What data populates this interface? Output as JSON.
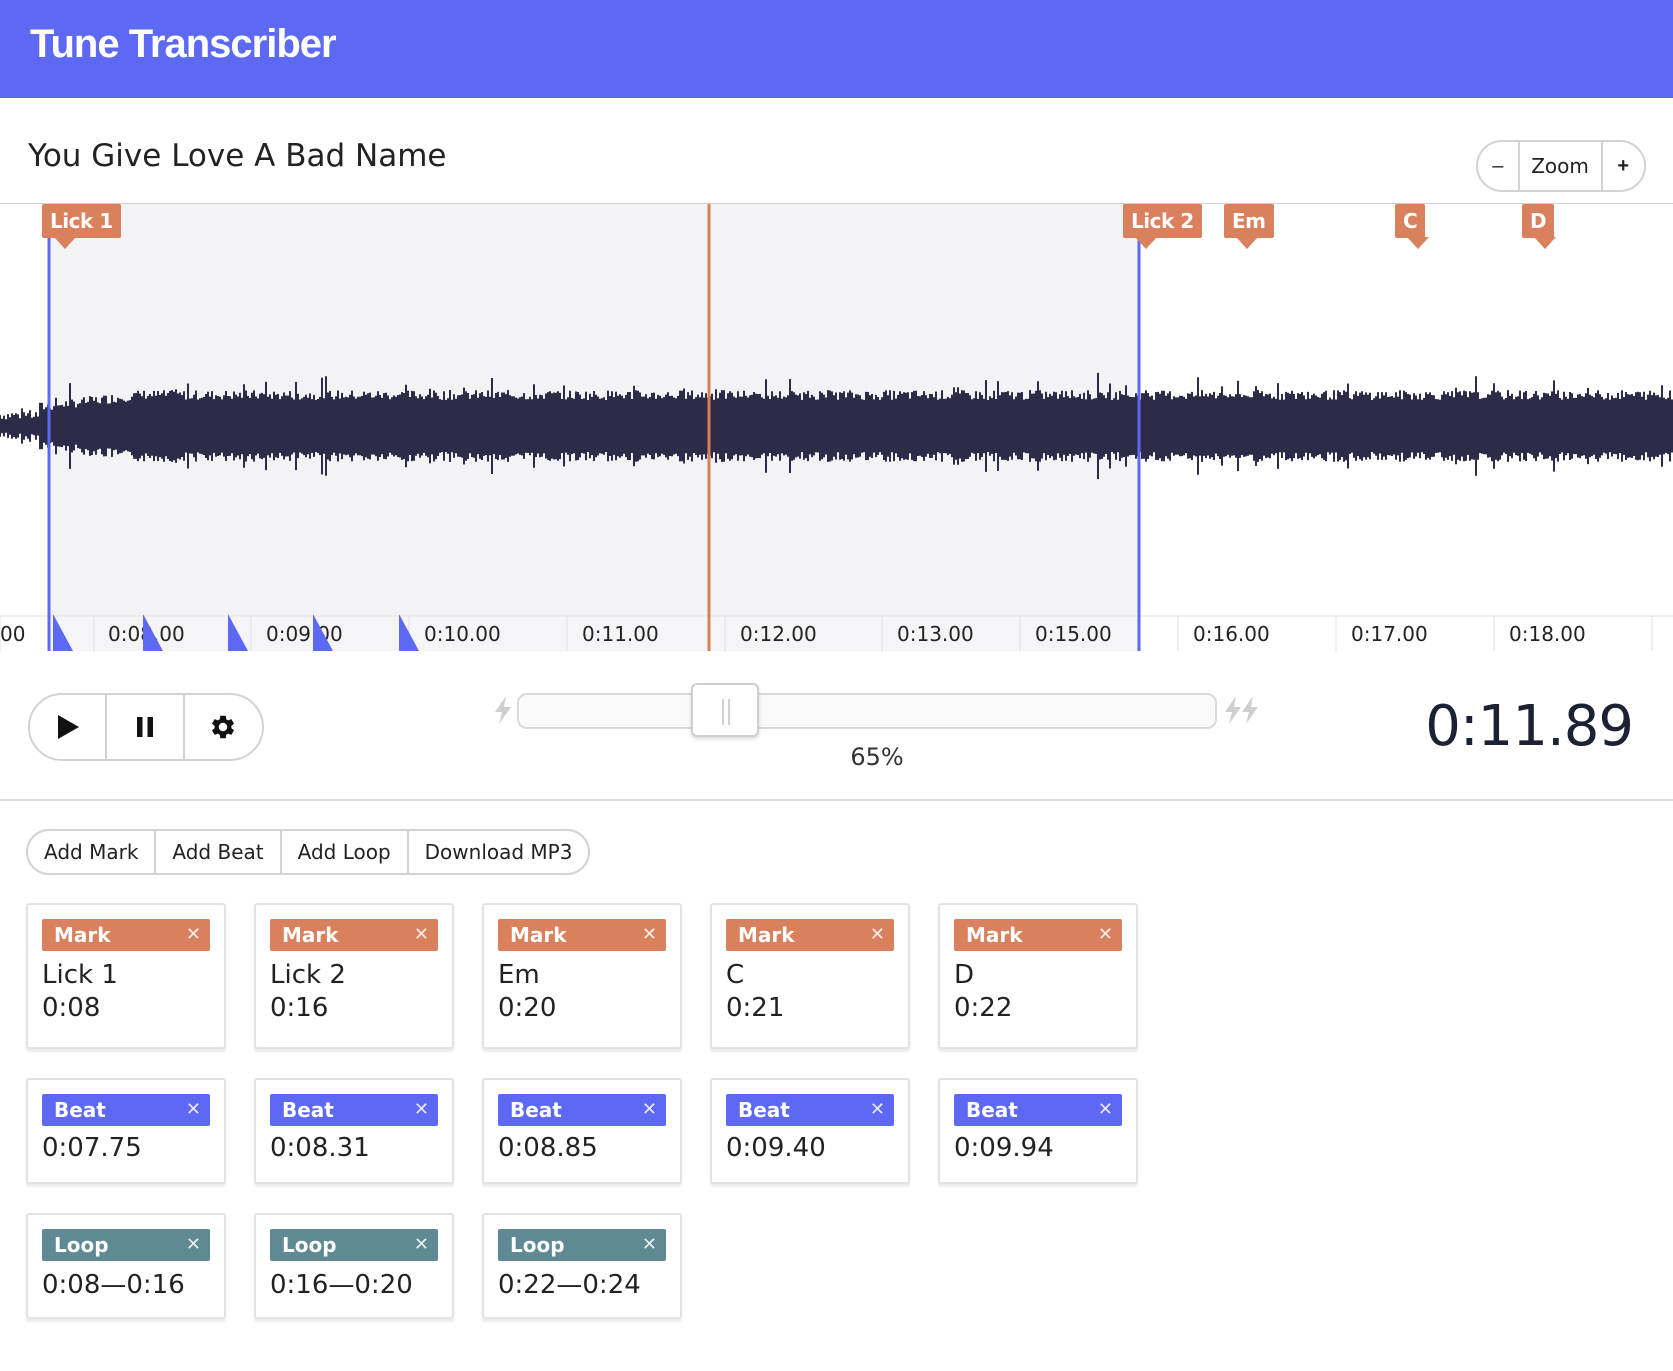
{
  "app": {
    "brand": "Tune Transcriber"
  },
  "song": {
    "title": "You Give Love A Bad Name"
  },
  "zoom": {
    "minus": "–",
    "label": "Zoom",
    "plus": "+"
  },
  "waveform": {
    "markers": [
      "Lick 1",
      "Lick 2",
      "Em",
      "C",
      "D"
    ],
    "time_labels": [
      "00",
      "0:08.00",
      "0:09.00",
      "0:10.00",
      "0:11.00",
      "0:12.00",
      "0:13.00",
      "0:15.00",
      "0:16.00",
      "0:17.00",
      "0:18.00"
    ],
    "colors": {
      "wave": "#2d2c48",
      "loop_region": "#f3f3f5",
      "loop_line": "#5d69f2",
      "playhead": "#d9805d",
      "beat": "#5d69f2"
    }
  },
  "transport": {
    "play_icon": "play-icon",
    "pause_icon": "pause-icon",
    "settings_icon": "gear-icon"
  },
  "speed": {
    "percent": "65%",
    "value": 0.65
  },
  "clock": {
    "current_time": "0:11.89"
  },
  "actions": {
    "add_mark": "Add Mark",
    "add_beat": "Add Beat",
    "add_loop": "Add Loop",
    "download": "Download MP3"
  },
  "cards": {
    "marks": [
      {
        "tag": "Mark",
        "name": "Lick 1",
        "time": "0:08"
      },
      {
        "tag": "Mark",
        "name": "Lick 2",
        "time": "0:16"
      },
      {
        "tag": "Mark",
        "name": "Em",
        "time": "0:20"
      },
      {
        "tag": "Mark",
        "name": "C",
        "time": "0:21"
      },
      {
        "tag": "Mark",
        "name": "D",
        "time": "0:22"
      }
    ],
    "beats": [
      {
        "tag": "Beat",
        "time": "0:07.75"
      },
      {
        "tag": "Beat",
        "time": "0:08.31"
      },
      {
        "tag": "Beat",
        "time": "0:08.85"
      },
      {
        "tag": "Beat",
        "time": "0:09.40"
      },
      {
        "tag": "Beat",
        "time": "0:09.94"
      }
    ],
    "loops": [
      {
        "tag": "Loop",
        "time": "0:08—0:16"
      },
      {
        "tag": "Loop",
        "time": "0:16—0:20"
      },
      {
        "tag": "Loop",
        "time": "0:22—0:24"
      }
    ],
    "close_glyph": "✕"
  }
}
